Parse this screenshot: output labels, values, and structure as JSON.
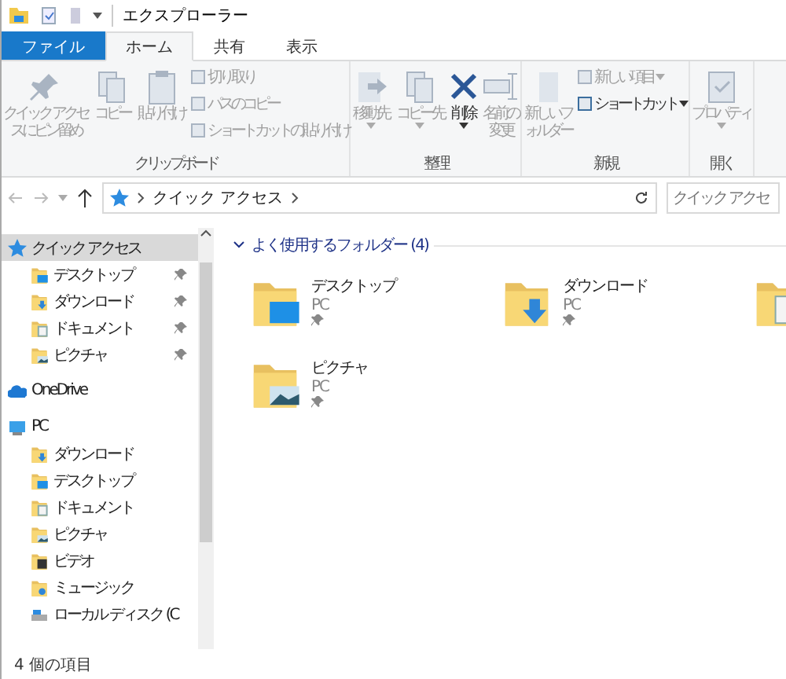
{
  "window": {
    "title": "エクスプローラー"
  },
  "tabs": [
    {
      "label": "ファイル",
      "kind": "file",
      "selected": false
    },
    {
      "label": "ホーム",
      "kind": "tab",
      "selected": true
    },
    {
      "label": "共有",
      "kind": "tab",
      "selected": false
    },
    {
      "label": "表示",
      "kind": "tab",
      "selected": false
    }
  ],
  "ribbon": [
    {
      "name": "クリップボード",
      "items": [
        {
          "kind": "large",
          "label": "クイック アクセスにピン留め",
          "disabled": true,
          "dropdown": false
        },
        {
          "kind": "large",
          "label": "コピー",
          "disabled": true,
          "dropdown": false
        },
        {
          "kind": "large",
          "label": "貼り付け",
          "disabled": true,
          "dropdown": false
        },
        {
          "kind": "small",
          "label": "切り取り",
          "disabled": true,
          "dropdown": false
        },
        {
          "kind": "small",
          "label": "パスのコピー",
          "disabled": true,
          "dropdown": false
        },
        {
          "kind": "small",
          "label": "ショートカットの貼り付け",
          "disabled": true,
          "dropdown": false
        }
      ]
    },
    {
      "name": "整理",
      "items": [
        {
          "kind": "large",
          "label": "移動先",
          "disabled": true,
          "dropdown": true
        },
        {
          "kind": "large",
          "label": "コピー先",
          "disabled": true,
          "dropdown": true
        },
        {
          "kind": "large",
          "label": "削除",
          "disabled": false,
          "dropdown": true
        },
        {
          "kind": "large",
          "label": "名前の変更",
          "disabled": true,
          "dropdown": false
        }
      ]
    },
    {
      "name": "新規",
      "items": [
        {
          "kind": "large",
          "label": "新しいフォルダー",
          "disabled": true,
          "dropdown": false
        },
        {
          "kind": "small",
          "label": "新しい項目",
          "disabled": true,
          "dropdown": true
        },
        {
          "kind": "small",
          "label": "ショートカット",
          "disabled": false,
          "dropdown": true
        }
      ]
    },
    {
      "name": "開く",
      "items": [
        {
          "kind": "large",
          "label": "プロパティ",
          "disabled": true,
          "dropdown": true
        }
      ]
    }
  ],
  "address": {
    "path": [
      "クイック アクセス"
    ],
    "search_placeholder": "クイック アクセ"
  },
  "sidebar": {
    "items": [
      {
        "label": "クイック アクセス",
        "kind": "quick",
        "selected": true,
        "children": [
          {
            "label": "デスクトップ",
            "kind": "desktop",
            "pinned": true,
            "selected": false
          },
          {
            "label": "ダウンロード",
            "kind": "download",
            "pinned": true,
            "selected": false
          },
          {
            "label": "ドキュメント",
            "kind": "document",
            "pinned": true,
            "selected": false
          },
          {
            "label": "ピクチャ",
            "kind": "picture",
            "pinned": true,
            "selected": false
          }
        ]
      },
      {
        "label": "OneDrive",
        "kind": "cloud",
        "selected": false
      },
      {
        "label": "PC",
        "kind": "pc",
        "selected": false,
        "children": [
          {
            "label": "ダウンロード",
            "kind": "download",
            "pinned": false,
            "selected": false
          },
          {
            "label": "デスクトップ",
            "kind": "desktop",
            "pinned": false,
            "selected": false
          },
          {
            "label": "ドキュメント",
            "kind": "document",
            "pinned": false,
            "selected": false
          },
          {
            "label": "ピクチャ",
            "kind": "picture",
            "pinned": false,
            "selected": false
          },
          {
            "label": "ビデオ",
            "kind": "video",
            "pinned": false,
            "selected": false
          },
          {
            "label": "ミュージック",
            "kind": "music",
            "pinned": false,
            "selected": false
          },
          {
            "label": "ローカル ディスク (C",
            "kind": "disk",
            "pinned": false,
            "selected": false
          }
        ]
      }
    ]
  },
  "content": {
    "section": "よく使用するフォルダー (4)",
    "expanded": true,
    "folders": [
      {
        "name": "デスクトップ",
        "location": "PC",
        "kind": "desktop",
        "pinned": true
      },
      {
        "name": "ダウンロード",
        "location": "PC",
        "kind": "download",
        "pinned": true
      },
      {
        "kind": "document"
      },
      {
        "name": "ピクチャ",
        "location": "PC",
        "kind": "picture",
        "pinned": true
      }
    ]
  },
  "status_bar": {
    "text": "4 個の項目"
  }
}
